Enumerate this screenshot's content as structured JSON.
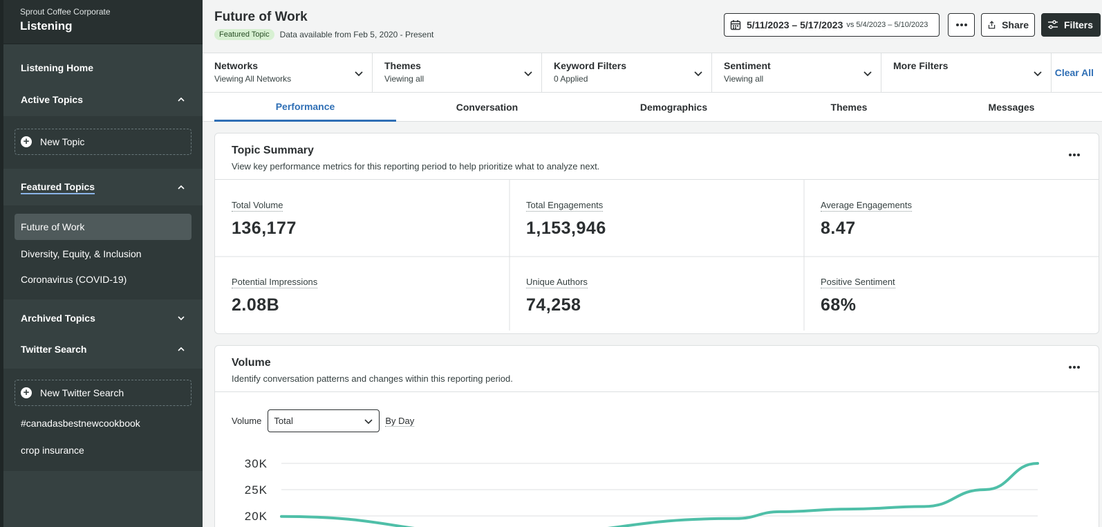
{
  "sidebar": {
    "org": "Sprout Coffee Corporate",
    "title": "Listening",
    "home": "Listening Home",
    "active_topics": "Active Topics",
    "new_topic": "New Topic",
    "featured_topics": "Featured Topics",
    "featured_items": [
      "Future of Work",
      "Diversity, Equity, & Inclusion",
      "Coronavirus (COVID-19)"
    ],
    "archived_topics": "Archived Topics",
    "twitter_search": "Twitter Search",
    "new_twitter_search": "New Twitter Search",
    "twitter_items": [
      "#canadasbestnewcookbook",
      "crop insurance"
    ]
  },
  "header": {
    "title": "Future of Work",
    "badge": "Featured Topic",
    "availability": "Data available from Feb 5, 2020 - Present",
    "date_range": "5/11/2023 – 5/17/2023",
    "compare": "vs 5/4/2023 – 5/10/2023",
    "share": "Share",
    "filters": "Filters"
  },
  "filters": [
    {
      "title": "Networks",
      "sub": "Viewing All Networks"
    },
    {
      "title": "Themes",
      "sub": "Viewing all"
    },
    {
      "title": "Keyword Filters",
      "sub": "0 Applied"
    },
    {
      "title": "Sentiment",
      "sub": "Viewing all"
    },
    {
      "title": "More Filters",
      "sub": ""
    }
  ],
  "clear_all": "Clear All",
  "tabs": [
    "Performance",
    "Conversation",
    "Demographics",
    "Themes",
    "Messages"
  ],
  "summary": {
    "title": "Topic Summary",
    "desc": "View key performance metrics for this reporting period to help prioritize what to analyze next.",
    "metrics": [
      {
        "label": "Total Volume",
        "value": "136,177"
      },
      {
        "label": "Total Engagements",
        "value": "1,153,946"
      },
      {
        "label": "Average Engagements",
        "value": "8.47"
      },
      {
        "label": "Potential Impressions",
        "value": "2.08B"
      },
      {
        "label": "Unique Authors",
        "value": "74,258"
      },
      {
        "label": "Positive Sentiment",
        "value": "68%"
      }
    ]
  },
  "volume": {
    "title": "Volume",
    "desc": "Identify conversation patterns and changes within this reporting period.",
    "control_label": "Volume",
    "select_value": "Total",
    "granularity": "By Day",
    "y_ticks": [
      "30K",
      "25K",
      "20K"
    ]
  },
  "chart_data": {
    "type": "line",
    "series_color": "#4fbfa8",
    "y_ticks": [
      30000,
      25000,
      20000
    ],
    "ylim": [
      0,
      30000
    ],
    "visible_points": [
      {
        "x": 0.0,
        "y": 19900
      },
      {
        "x": 0.3,
        "y": 16500
      },
      {
        "x": 0.6,
        "y": 19500
      },
      {
        "x": 0.66,
        "y": 20800
      },
      {
        "x": 0.75,
        "y": 21300
      },
      {
        "x": 0.85,
        "y": 21800
      },
      {
        "x": 0.93,
        "y": 25000
      },
      {
        "x": 1.0,
        "y": 30000
      }
    ]
  }
}
